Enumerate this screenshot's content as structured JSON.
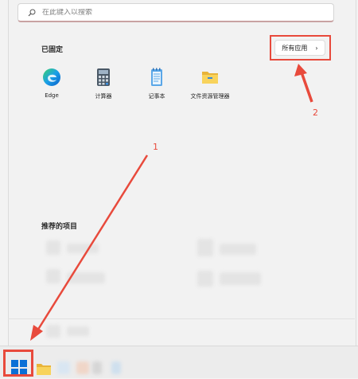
{
  "search": {
    "placeholder": "在此键入以搜索"
  },
  "pinned": {
    "title": "已固定",
    "all_apps_label": "所有应用",
    "apps": [
      {
        "label": "Edge",
        "icon": "edge-icon"
      },
      {
        "label": "计算器",
        "icon": "calculator-icon"
      },
      {
        "label": "记事本",
        "icon": "notepad-icon"
      },
      {
        "label": "文件资源管理器",
        "icon": "file-explorer-icon"
      }
    ]
  },
  "recommended": {
    "title": "推荐的项目"
  },
  "annotations": {
    "num1": "1",
    "num2": "2"
  },
  "colors": {
    "accent_red": "#e84a3c",
    "windows_blue": "#0a6fd6"
  }
}
